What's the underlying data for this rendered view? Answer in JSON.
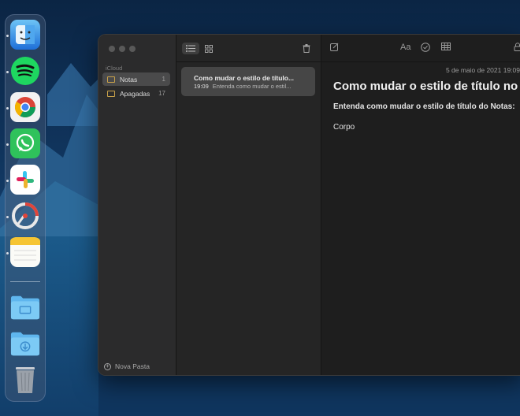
{
  "colors": {
    "accent_folder": "#c9a24a",
    "window_bg": "#1e1e1e",
    "sidebar_bg": "#2b2b2c",
    "selected_row": "#4a4a4b"
  },
  "dock": {
    "apps": [
      {
        "name": "finder",
        "icon": "finder-icon"
      },
      {
        "name": "spotify",
        "icon": "spotify-icon"
      },
      {
        "name": "chrome",
        "icon": "chrome-icon"
      },
      {
        "name": "whatsapp",
        "icon": "whatsapp-icon"
      },
      {
        "name": "slack",
        "icon": "slack-icon"
      },
      {
        "name": "screenrecorder",
        "icon": "recorder-icon"
      },
      {
        "name": "notes",
        "icon": "notes-icon"
      },
      {
        "name": "applications-folder",
        "icon": "folder-icon"
      },
      {
        "name": "downloads-folder",
        "icon": "downloads-icon"
      },
      {
        "name": "trash",
        "icon": "trash-icon"
      }
    ]
  },
  "sidebar": {
    "section": "iCloud",
    "folders": [
      {
        "label": "Notas",
        "count": "1"
      },
      {
        "label": "Apagadas",
        "count": "17"
      }
    ],
    "new_folder": "Nova Pasta"
  },
  "notelist": {
    "toolbar": {
      "list_icon": "list-icon",
      "grid_icon": "grid-icon",
      "trash_icon": "trash-icon"
    },
    "notes": [
      {
        "title": "Como mudar o estilo de título...",
        "time": "19:09",
        "preview": "Entenda como mudar o estil..."
      }
    ]
  },
  "editor": {
    "toolbar": {
      "compose_icon": "compose-icon",
      "format_label": "Aa",
      "checklist_icon": "checklist-icon",
      "table_icon": "table-icon",
      "lock_icon": "lock-icon"
    },
    "date": "5 de maio de 2021 19:09",
    "title": "Como mudar o estilo de título no c",
    "heading": "Entenda como mudar o estilo de título do Notas:",
    "body": "Corpo"
  }
}
